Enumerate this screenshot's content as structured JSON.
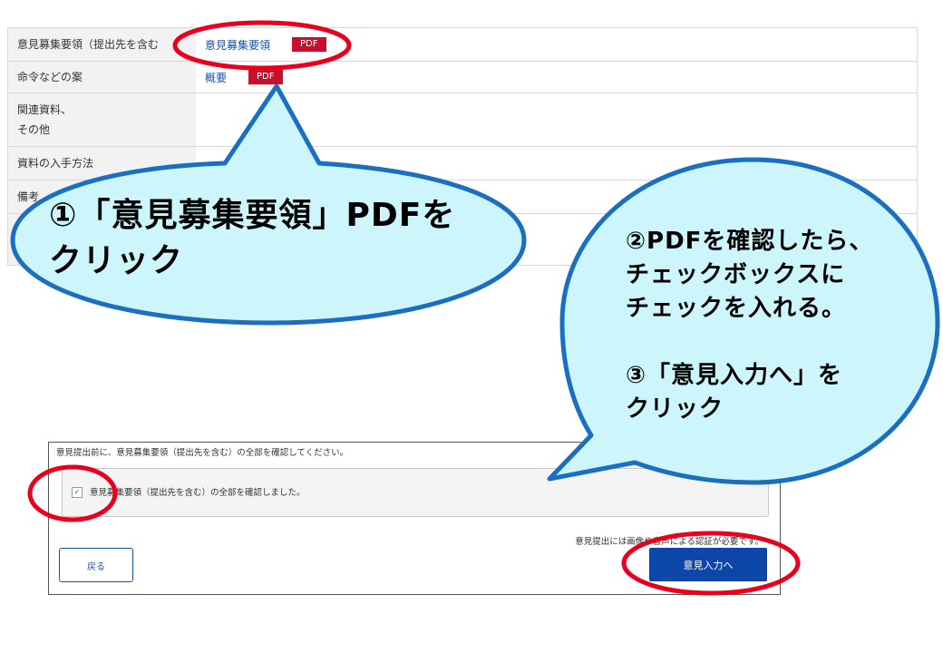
{
  "table": {
    "rows": [
      {
        "label": "意見募集要領（提出先を含む",
        "link": "意見募集要領",
        "badge": "PDF"
      },
      {
        "label": "命令などの案",
        "link": "概要",
        "badge": "PDF"
      },
      {
        "label": "関連資料、\nその他"
      },
      {
        "label": "資料の入手方法"
      },
      {
        "label": "備考"
      },
      {
        "label": ""
      }
    ]
  },
  "panel": {
    "note": "意見提出前に、意見募集要領（提出先を含む）の全部を確認してください。",
    "checkbox_label": "意見募集要領（提出先を含む）の全部を確認しました。",
    "checkbox_mark": "✓",
    "auth_note": "意見提出には画像や音声による認証が必要です。",
    "back_label": "戻る",
    "next_label": "意見入力へ"
  },
  "callouts": {
    "step1": "①「意見募集要領」PDFを\nクリック",
    "step2": "②PDFを確認したら、\nチェックボックスに\nチェックを入れる。\n\n③「意見入力へ」を\nクリック"
  },
  "colors": {
    "callout_fill": "#ccf6fb",
    "callout_stroke": "#1a6fc0",
    "highlight_ring": "#e8001c",
    "pdf_badge": "#c8102e",
    "primary_button": "#0b46a8"
  }
}
